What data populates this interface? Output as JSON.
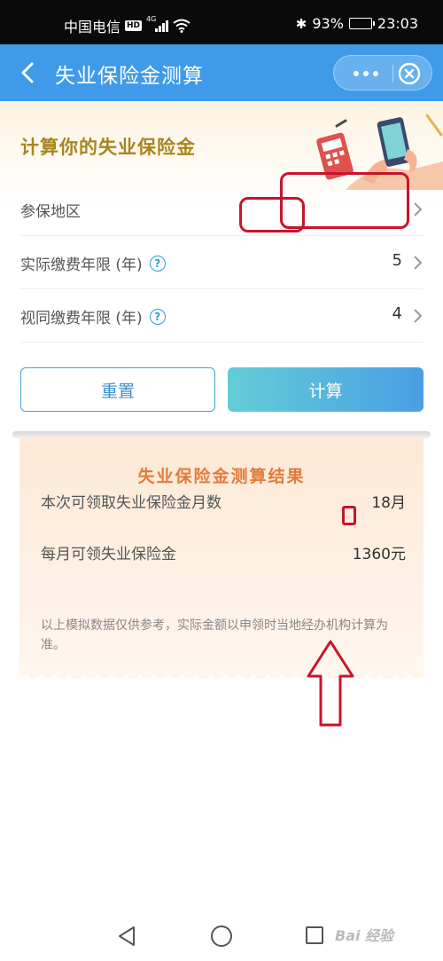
{
  "status_bar": {
    "carrier": "中国电信",
    "hd": "HD",
    "network": "4G",
    "battery": "93%",
    "battery_level": 0.93,
    "time": "23:03"
  },
  "header": {
    "title": "失业保险金测算",
    "more_icon": "more-icon",
    "close_icon": "close-circle-icon",
    "color": "#3f9be9"
  },
  "form": {
    "title": "计算你的失业保险金",
    "rows": [
      {
        "label": "参保地区",
        "value": "",
        "help": false
      },
      {
        "label": "实际缴费年限 (年)",
        "value": "5",
        "help": true
      },
      {
        "label": "视同缴费年限 (年)",
        "value": "4",
        "help": true
      }
    ],
    "help_glyph": "?",
    "reset_label": "重置",
    "calc_label": "计算"
  },
  "result": {
    "title": "失业保险金测算结果",
    "months_label": "本次可领取失业保险金月数",
    "months_value": "18月",
    "monthly_label": "每月可领失业保险金",
    "monthly_value": "1360元",
    "note": "以上模拟数据仅供参考，实际金额以申领时当地经办机构计算为准。"
  },
  "watermark": "Bai 经验",
  "colors": {
    "accent": "#3f9be9",
    "title_gold": "#a7861f",
    "result_orange": "#e47a3a",
    "annotation_red": "#c8142b"
  }
}
